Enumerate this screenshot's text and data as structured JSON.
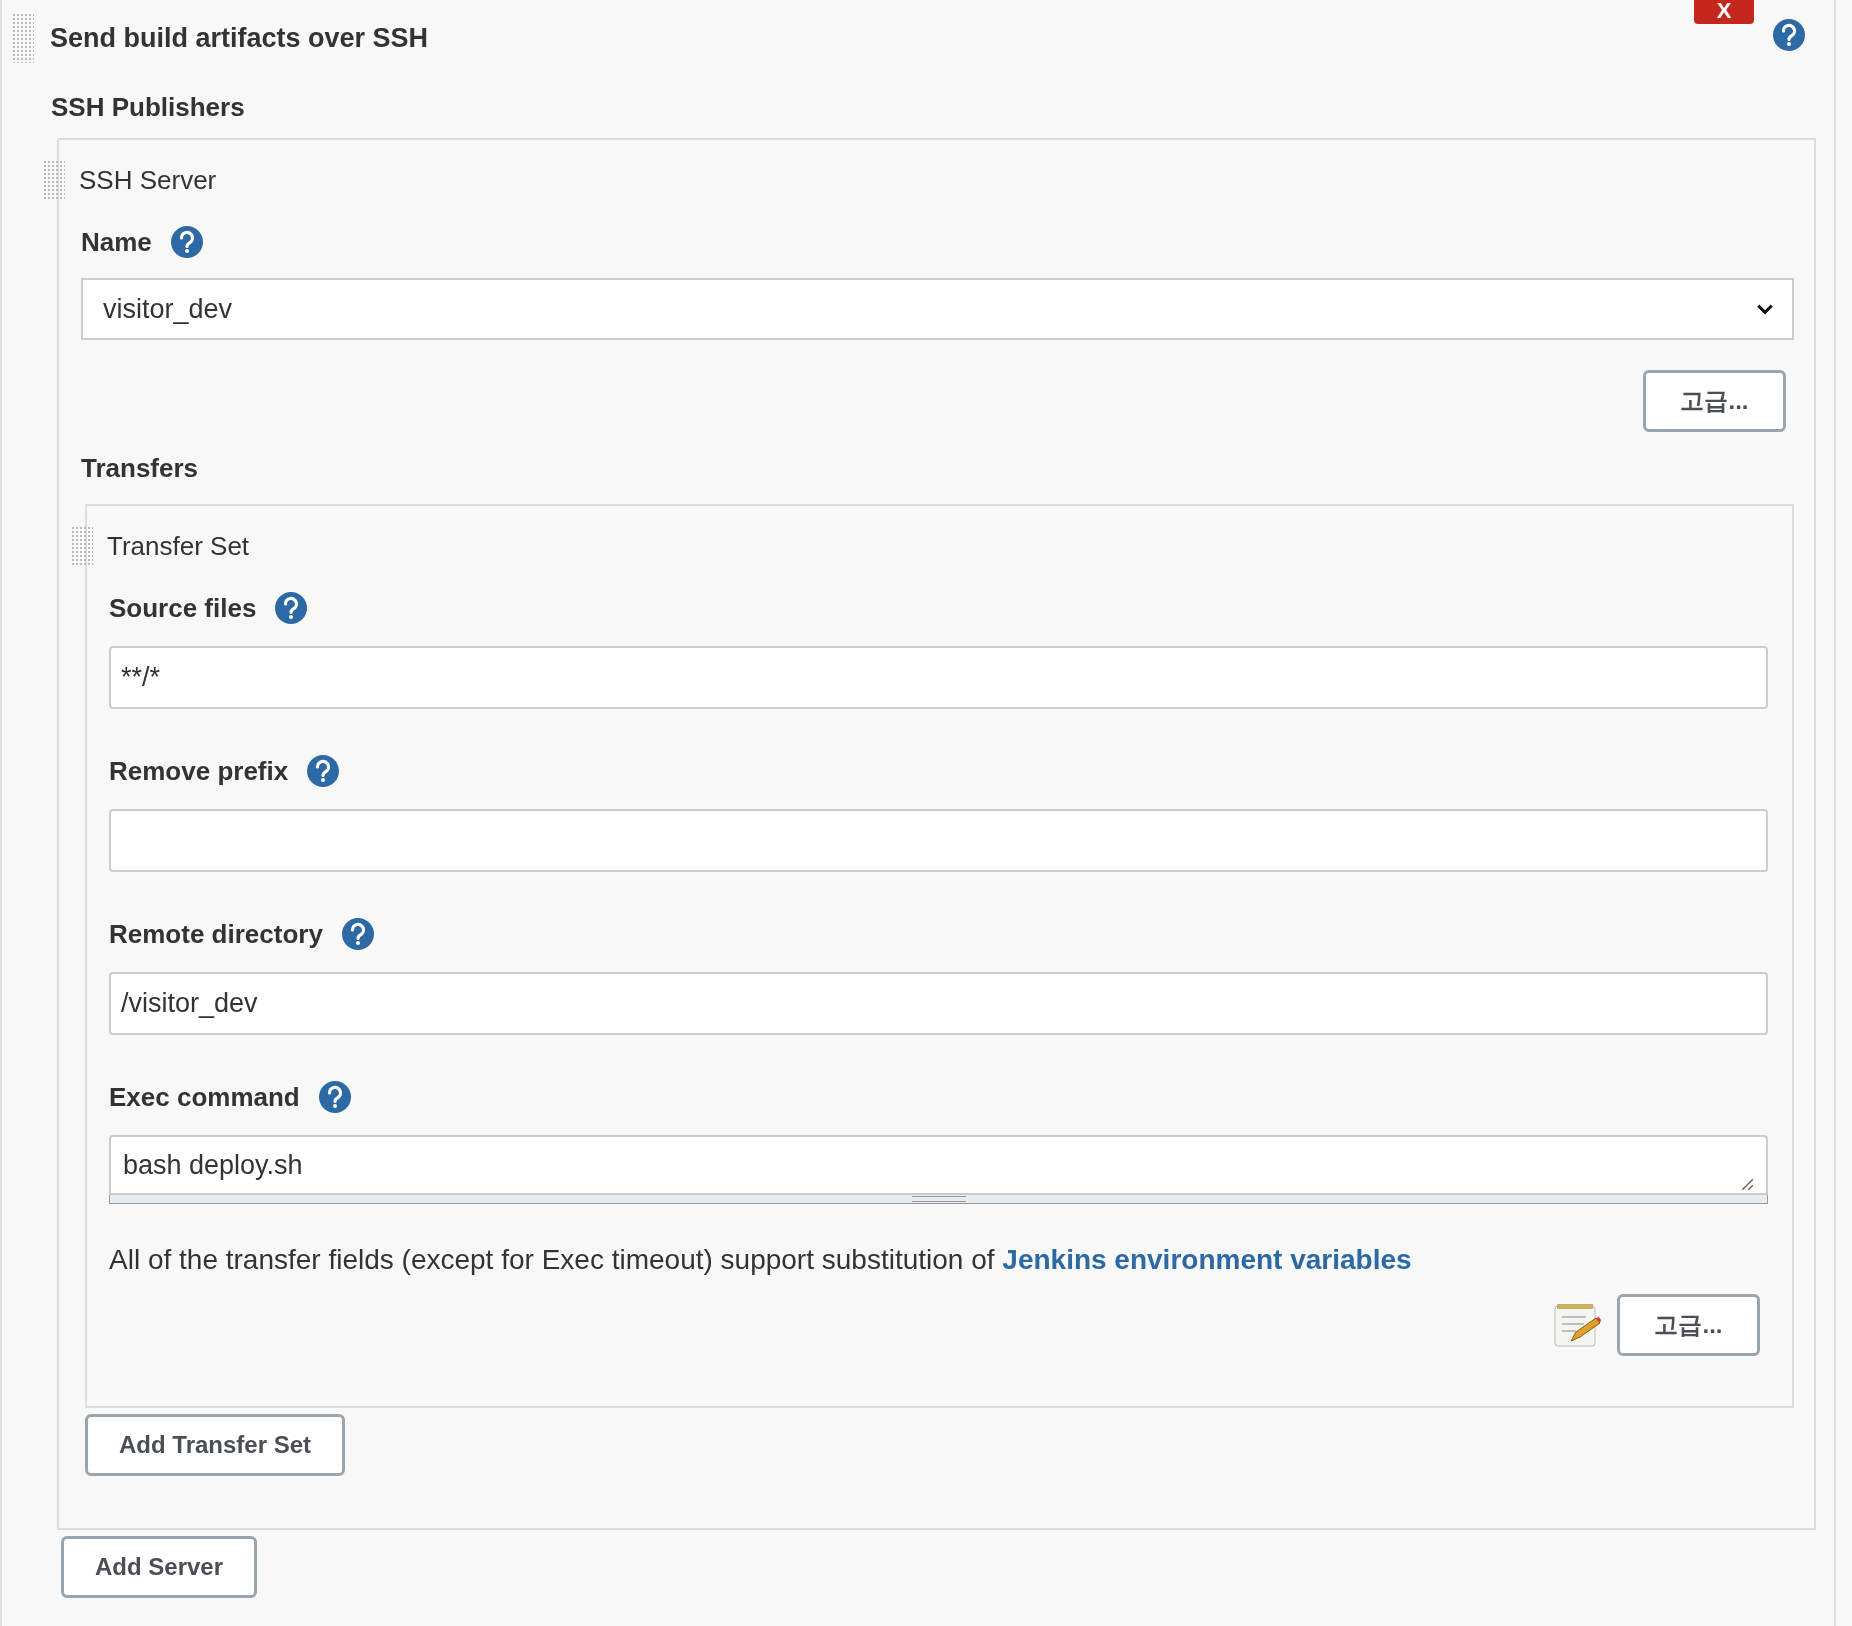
{
  "section": {
    "title": "Send build artifacts over SSH",
    "close_label": "X"
  },
  "publishers_label": "SSH Publishers",
  "server": {
    "title": "SSH Server",
    "name_label": "Name",
    "name_value": "visitor_dev",
    "advanced_button": "고급...",
    "transfers_label": "Transfers",
    "transfer_set": {
      "title": "Transfer Set",
      "fields": [
        {
          "kind": "input",
          "label": "Source files",
          "value": "**/*"
        },
        {
          "kind": "input",
          "label": "Remove prefix"
        },
        {
          "kind": "input",
          "label": "Remote directory",
          "value": "/visitor_dev"
        },
        {
          "kind": "textarea",
          "label": "Exec command",
          "value": "bash deploy.sh"
        }
      ],
      "note": "All of the transfer fields (except for Exec timeout) support substitution of ",
      "note_link": "Jenkins environment variables",
      "advanced_button": "고급..."
    },
    "add_transfer_button": "Add Transfer Set"
  },
  "add_server_button": "Add Server"
}
